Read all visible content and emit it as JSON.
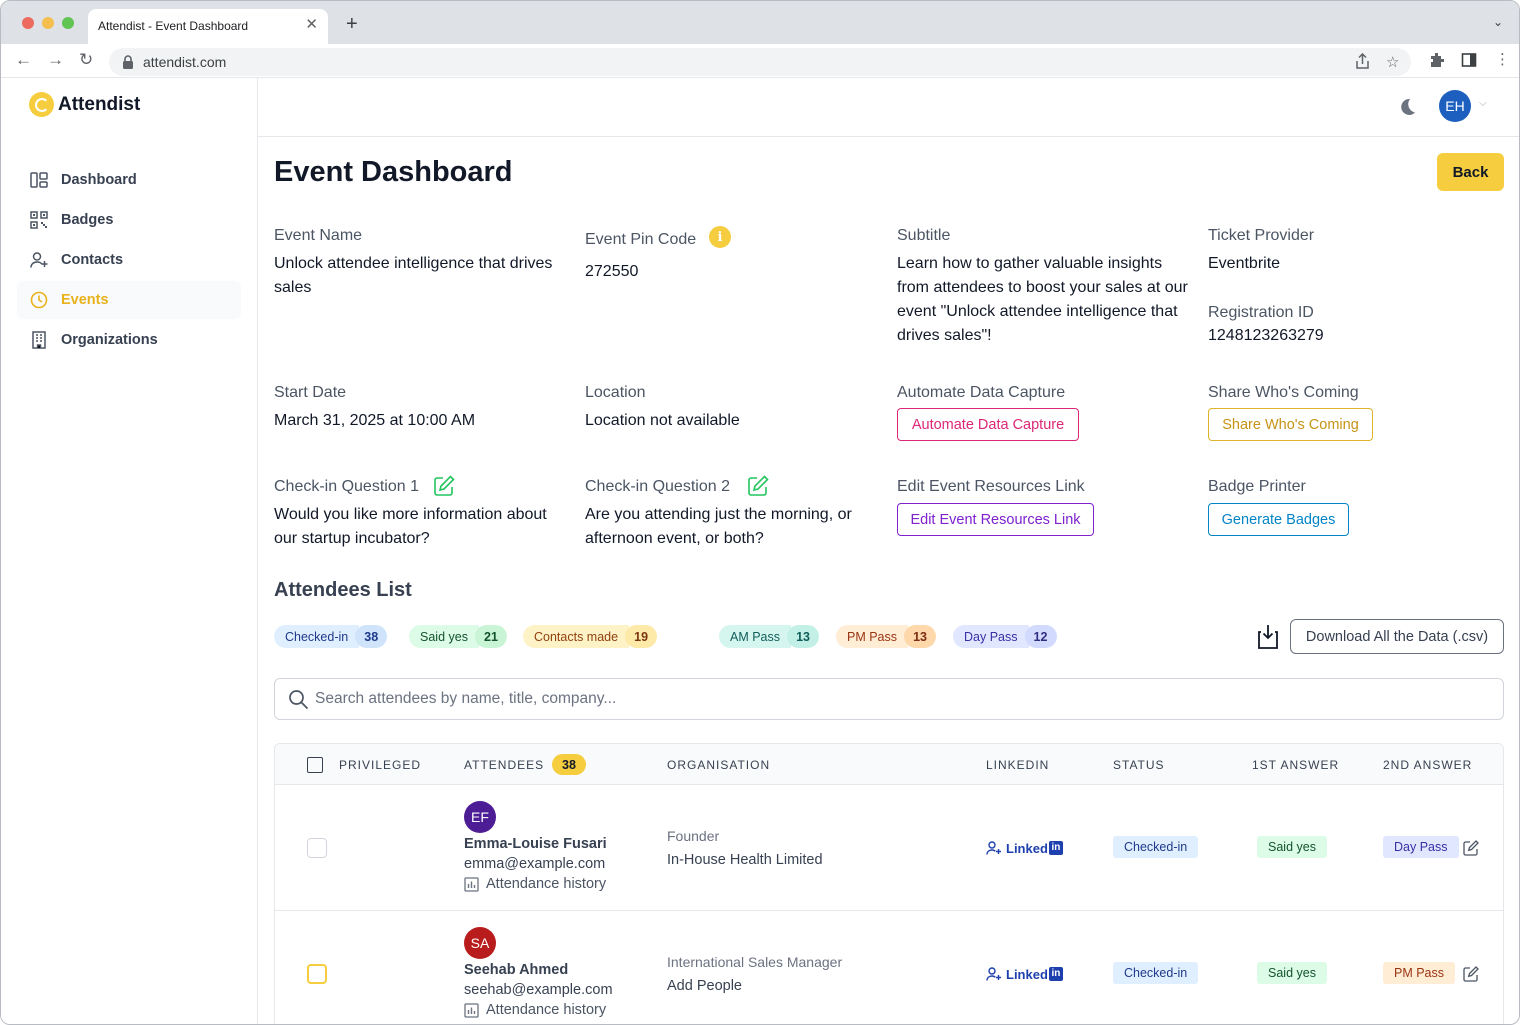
{
  "browser": {
    "tab_title": "Attendist - Event Dashboard",
    "url": "attendist.com"
  },
  "app": {
    "logo_text": "Attendist",
    "user_initials": "EH"
  },
  "sidebar": {
    "items": [
      {
        "label": "Dashboard",
        "icon": "dashboard-icon"
      },
      {
        "label": "Badges",
        "icon": "qr-code-icon"
      },
      {
        "label": "Contacts",
        "icon": "user-plus-icon"
      },
      {
        "label": "Events",
        "icon": "clock-icon",
        "active": true
      },
      {
        "label": "Organizations",
        "icon": "building-icon"
      }
    ]
  },
  "page": {
    "title": "Event Dashboard",
    "back_label": "Back"
  },
  "fields": {
    "event_name": {
      "label": "Event Name",
      "value": "Unlock attendee intelligence that drives sales"
    },
    "pin_code": {
      "label": "Event Pin Code",
      "value": "272550"
    },
    "subtitle": {
      "label": "Subtitle",
      "value": "Learn how to gather valuable insights from attendees to boost your sales at our event \"Unlock attendee intelligence that drives sales\"!"
    },
    "ticket_provider": {
      "label": "Ticket Provider",
      "value": "Eventbrite"
    },
    "registration_id": {
      "label": "Registration ID",
      "value": "1248123263279"
    },
    "start_date": {
      "label": "Start Date",
      "value": "March 31, 2025 at 10:00 AM"
    },
    "location": {
      "label": "Location",
      "value": "Location not available"
    },
    "automate": {
      "label": "Automate Data Capture",
      "button": "Automate Data Capture"
    },
    "share": {
      "label": "Share Who's Coming",
      "button": "Share Who's Coming"
    },
    "q1": {
      "label": "Check-in Question 1",
      "value": "Would you like more information about our startup incubator?"
    },
    "q2": {
      "label": "Check-in Question 2",
      "value": "Are you attending just the morning, or afternoon event, or both?"
    },
    "resources": {
      "label": "Edit Event Resources Link",
      "button": "Edit Event Resources Link"
    },
    "badge_printer": {
      "label": "Badge Printer",
      "button": "Generate Badges"
    }
  },
  "attendees": {
    "title": "Attendees List",
    "stats": [
      {
        "label": "Checked-in",
        "count": "38"
      },
      {
        "label": "Said yes",
        "count": "21"
      },
      {
        "label": "Contacts made",
        "count": "19"
      },
      {
        "label": "AM Pass",
        "count": "13"
      },
      {
        "label": "PM Pass",
        "count": "13"
      },
      {
        "label": "Day Pass",
        "count": "12"
      }
    ],
    "download_label": "Download All the Data (.csv)",
    "search_placeholder": "Search attendees by name, title, company...",
    "columns": [
      "Privileged",
      "Attendees",
      "Organisation",
      "LinkedIn",
      "Status",
      "1st Answer",
      "2nd Answer"
    ],
    "total": "38",
    "rows": [
      {
        "initials": "EF",
        "avatar_color": "#4c1d95",
        "name": "Emma-Louise Fusari",
        "email": "emma@example.com",
        "history": "Attendance history",
        "title": "Founder",
        "org": "In-House Health Limited",
        "linkedin": "Linked",
        "status": "Checked-in",
        "answer1": "Said yes",
        "answer2": "Day Pass"
      },
      {
        "initials": "SA",
        "avatar_color": "#b91c1c",
        "name": "Seehab Ahmed",
        "email": "seehab@example.com",
        "history": "Attendance history",
        "title": "International Sales Manager",
        "org": "Add People",
        "linkedin": "Linked",
        "status": "Checked-in",
        "answer1": "Said yes",
        "answer2": "PM Pass"
      }
    ]
  },
  "colors": {
    "accent": "#f5cd3e",
    "avatar_top": "#1d5fbf"
  }
}
